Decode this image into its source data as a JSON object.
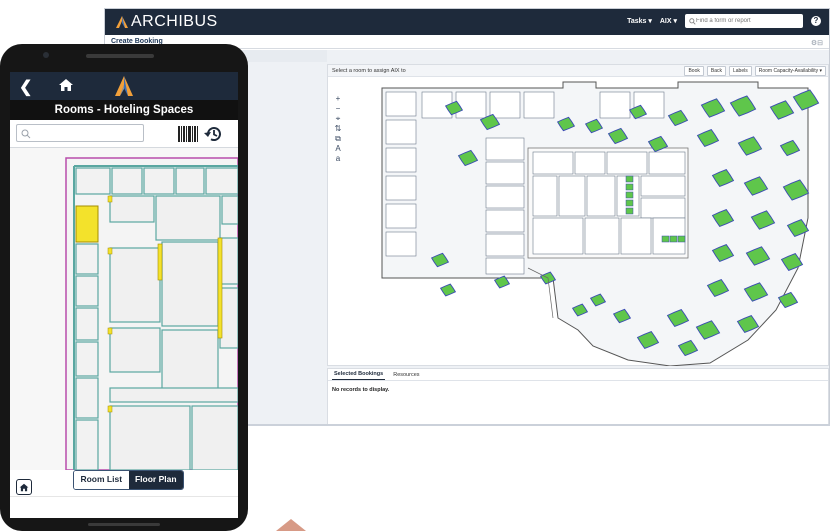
{
  "desktop": {
    "brand_name": "ARCHIBUS",
    "menu_tasks": "Tasks ▾",
    "menu_user": "AIX ▾",
    "search_placeholder": "Find a form or report",
    "help_icon": "?",
    "page_title": "Create Booking",
    "toolbar_icons": "⚙⊟",
    "plan_panel": {
      "instruction": "Select a room to assign AIX to",
      "buttons": [
        "Book",
        "Back",
        "Labels",
        "Room Capacity-Availability ▾"
      ]
    },
    "bottom_panel": {
      "tabs": [
        "Selected Bookings",
        "Resources"
      ],
      "empty_message": "No records to display."
    },
    "tool_glyphs": [
      "+",
      "−",
      "⌖",
      "⇅",
      "⧉",
      "A",
      "a"
    ]
  },
  "mobile": {
    "back_glyph": "❮",
    "title": "Rooms - Hoteling Spaces",
    "search_placeholder": "",
    "segment": {
      "room_list": "Room List",
      "floor_plan": "Floor Plan",
      "active": "Floor Plan"
    }
  },
  "colors": {
    "navy": "#1e2a3b",
    "available_room": "#5fc64b",
    "selected_room": "#f3e22b",
    "room_outline": "#3a4bb3",
    "wall": "#5aa7a1"
  }
}
